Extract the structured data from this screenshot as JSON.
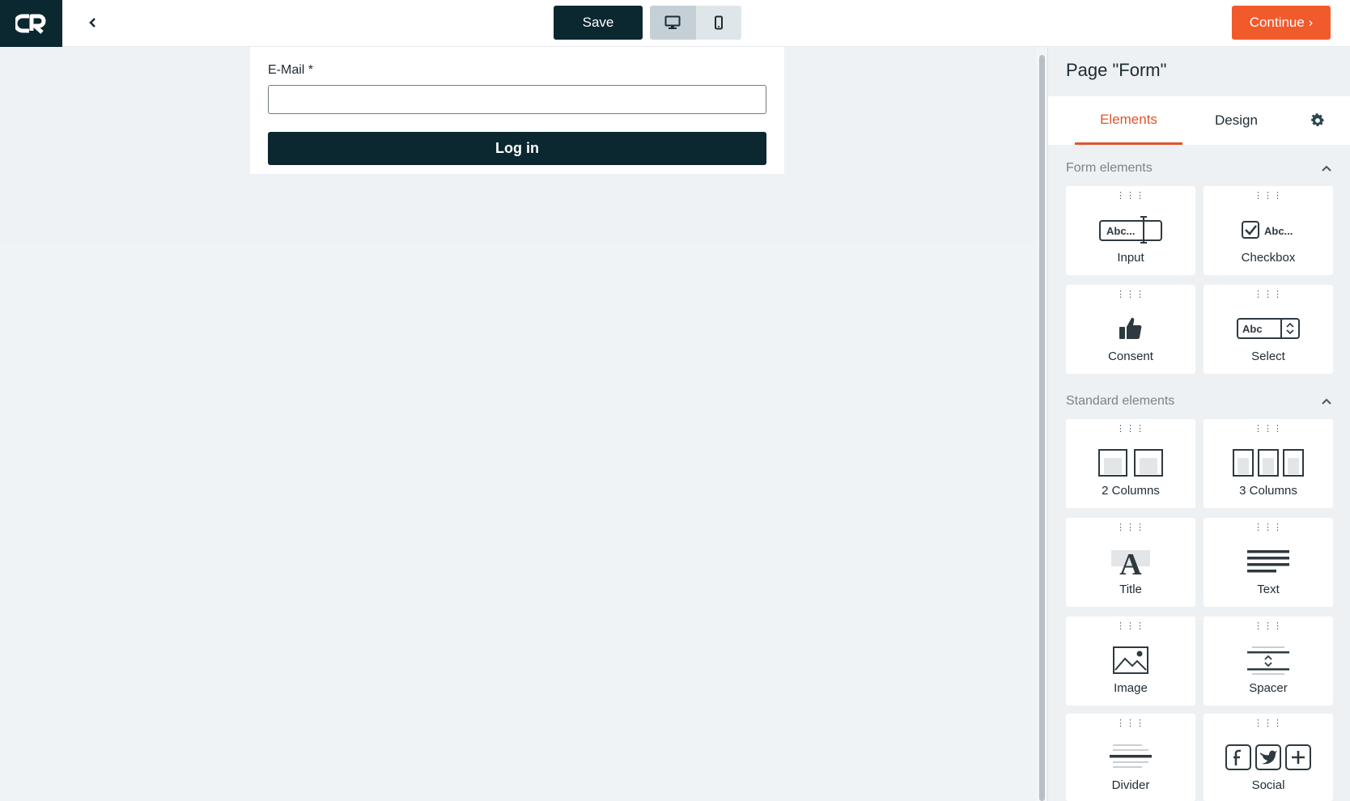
{
  "topbar": {
    "logo_text": "CR",
    "save_label": "Save",
    "continue_label": "Continue ›",
    "devices": [
      "desktop-icon",
      "mobile-icon"
    ]
  },
  "form": {
    "email_label": "E-Mail *",
    "email_value": "",
    "login_label": "Log in"
  },
  "sidebar": {
    "title": "Page \"Form\"",
    "tabs": [
      {
        "label": "Elements",
        "active": true
      },
      {
        "label": "Design",
        "active": false
      }
    ],
    "settings_icon": "gear-icon",
    "form_elements": {
      "title": "Form elements",
      "items": [
        {
          "label": "Input",
          "icon": "input-icon"
        },
        {
          "label": "Checkbox",
          "icon": "checkbox-icon"
        },
        {
          "label": "Consent",
          "icon": "thumbs-up-icon"
        },
        {
          "label": "Select",
          "icon": "select-icon"
        }
      ]
    },
    "standard_elements": {
      "title": "Standard elements",
      "items": [
        {
          "label": "2 Columns",
          "icon": "two-columns-icon"
        },
        {
          "label": "3 Columns",
          "icon": "three-columns-icon"
        },
        {
          "label": "Title",
          "icon": "title-icon"
        },
        {
          "label": "Text",
          "icon": "text-icon"
        },
        {
          "label": "Image",
          "icon": "image-icon"
        },
        {
          "label": "Spacer",
          "icon": "spacer-icon"
        },
        {
          "label": "Divider",
          "icon": "divider-icon"
        },
        {
          "label": "Social",
          "icon": "social-icon"
        }
      ]
    },
    "icon_text": {
      "input": "Abc...",
      "checkbox": "Abc...",
      "select": "Abc",
      "title": "A"
    }
  },
  "colors": {
    "dark": "#0b2730",
    "accent": "#f15a2b",
    "canvas_bg": "#eef2f5"
  }
}
